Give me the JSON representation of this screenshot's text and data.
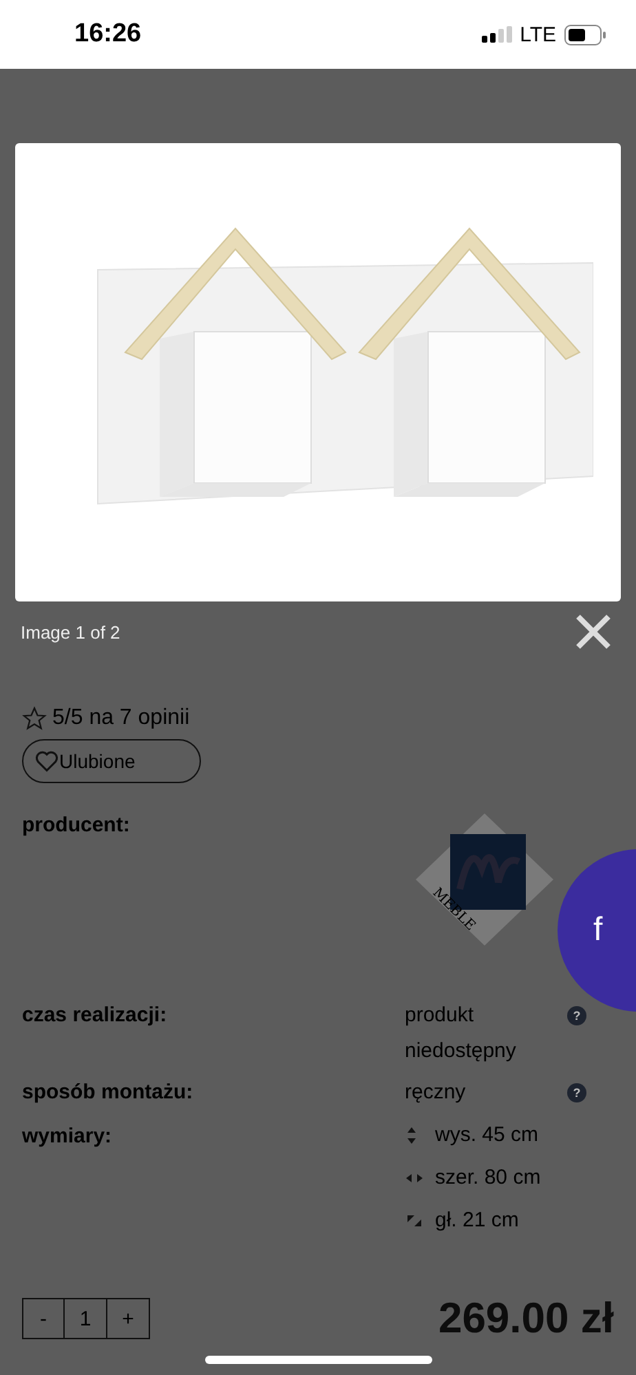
{
  "status_bar": {
    "time": "16:26",
    "network": "LTE"
  },
  "lightbox": {
    "caption": "Image 1 of 2"
  },
  "product": {
    "rating": "5/5 na 7 opinii",
    "favourite": "Ulubione",
    "specs": [
      {
        "kind": "logo",
        "label": "producent:",
        "brand": "MEBLE"
      },
      {
        "kind": "text",
        "label": "czas realizacji:",
        "value": "produkt niedostępny",
        "help": "?"
      },
      {
        "kind": "text",
        "label": "sposób montażu:",
        "value": "ręczny",
        "help": "?"
      },
      {
        "kind": "dimensions",
        "label": "wymiary:",
        "dims": [
          {
            "kind": "height",
            "text": "wys. 45 cm"
          },
          {
            "kind": "width",
            "text": "szer. 80 cm"
          },
          {
            "kind": "depth",
            "text": "gł. 21 cm"
          }
        ]
      }
    ],
    "quantity": {
      "minus": "-",
      "value": "1",
      "plus": "+"
    },
    "price": "269.00 zł"
  },
  "social": {
    "label": "f"
  }
}
